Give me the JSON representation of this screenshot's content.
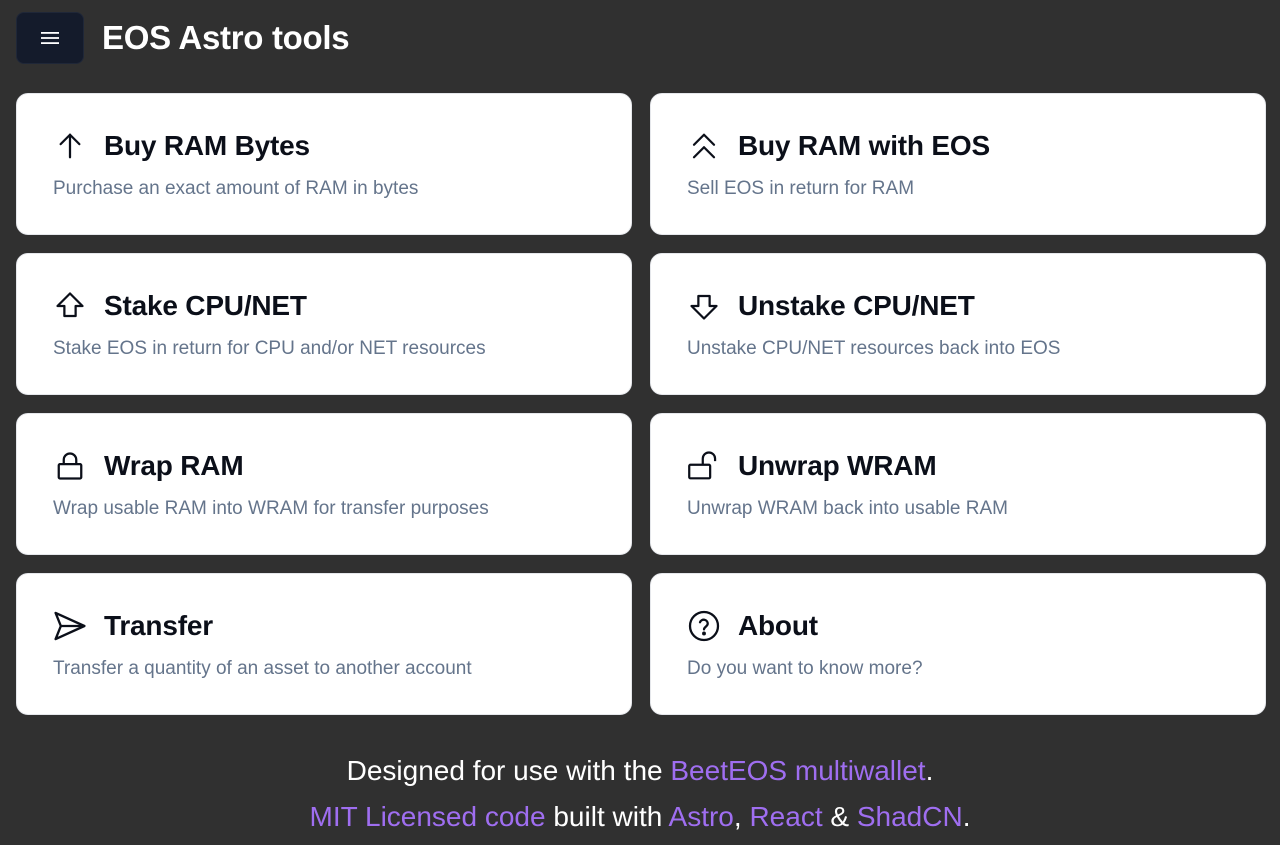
{
  "header": {
    "menu_icon": "hamburger-icon",
    "title": "EOS Astro tools"
  },
  "cards": [
    {
      "icon": "arrow-up-icon",
      "title": "Buy RAM Bytes",
      "description": "Purchase an exact amount of RAM in bytes"
    },
    {
      "icon": "double-chevron-up-icon",
      "title": "Buy RAM with EOS",
      "description": "Sell EOS in return for RAM"
    },
    {
      "icon": "stake-arrow-up-icon",
      "title": "Stake CPU/NET",
      "description": "Stake EOS in return for CPU and/or NET resources"
    },
    {
      "icon": "unstake-arrow-down-icon",
      "title": "Unstake CPU/NET",
      "description": "Unstake CPU/NET resources back into EOS"
    },
    {
      "icon": "lock-icon",
      "title": "Wrap RAM",
      "description": "Wrap usable RAM into WRAM for transfer purposes"
    },
    {
      "icon": "unlock-icon",
      "title": "Unwrap WRAM",
      "description": "Unwrap WRAM back into usable RAM"
    },
    {
      "icon": "send-icon",
      "title": "Transfer",
      "description": "Transfer a quantity of an asset to another account"
    },
    {
      "icon": "question-circle-icon",
      "title": "About",
      "description": "Do you want to know more?"
    }
  ],
  "footer": {
    "line1_prefix": "Designed for use with the ",
    "line1_link": "BeetEOS multiwallet",
    "line1_suffix": ".",
    "line2_link_code": "MIT Licensed code",
    "line2_built_with": " built with ",
    "line2_link_astro": "Astro",
    "line2_comma": ", ",
    "line2_link_react": "React",
    "line2_amp": " & ",
    "line2_link_shadcn": "ShadCN",
    "line2_suffix": "."
  },
  "colors": {
    "background": "#303030",
    "card": "#ffffff",
    "link": "#9f6ef0",
    "menu_button": "#141b2b",
    "description": "#64748b"
  }
}
